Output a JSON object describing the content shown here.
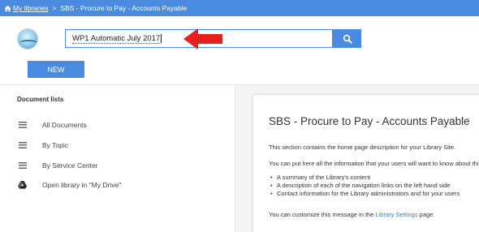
{
  "breadcrumb": {
    "home_label": "My libraries",
    "separator": ">",
    "current": "SBS - Procure to Pay - Accounts Payable"
  },
  "search": {
    "value": "WP1 Automatic July 2017"
  },
  "toolbar": {
    "new_label": "NEW"
  },
  "sidebar": {
    "title": "Document lists",
    "items": [
      {
        "label": "All Documents",
        "icon": "list-icon"
      },
      {
        "label": "By Topic",
        "icon": "list-icon"
      },
      {
        "label": "By Service Center",
        "icon": "list-icon"
      },
      {
        "label": "Open library in \"My Drive\"",
        "icon": "google-drive-icon"
      }
    ]
  },
  "content": {
    "title": "SBS - Procure to Pay - Accounts Payable",
    "para1": "This section contains the home page description for your Library Site.",
    "para2": "You can put here all the information that your users will want to know about this library:",
    "bullets": [
      "A summary of the Library's content",
      "A description of each of the navigation links on the left hand side",
      "Contact information for the Library administrators and for your users"
    ],
    "para3_prefix": "You can customize this message in the ",
    "para3_link": "Library Settings",
    "para3_suffix": " page"
  },
  "colors": {
    "accent": "#4a8bdf",
    "annotation_arrow": "#e8201c",
    "link": "#2f7ed8"
  }
}
